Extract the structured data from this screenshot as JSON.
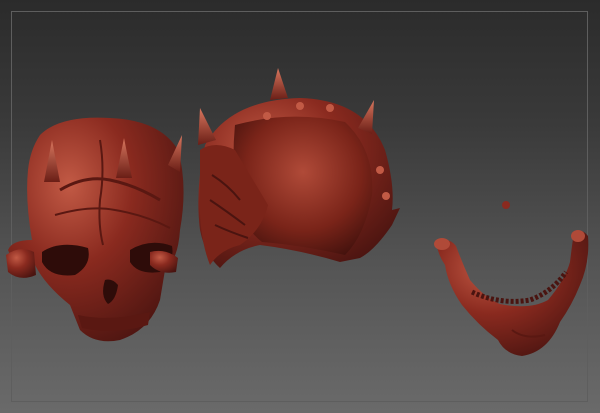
{
  "viewport": {
    "background_top": "#2b2b2b",
    "background_bottom": "#6a6a6a",
    "frame_color": "#5e5e5e"
  },
  "material": {
    "base": "#8a2a1f",
    "highlight": "#c25a45",
    "shadow": "#4a1410"
  },
  "objects": [
    {
      "name": "skull-face-mask-model"
    },
    {
      "name": "skull-back-shell-model"
    },
    {
      "name": "jaw-model"
    }
  ]
}
